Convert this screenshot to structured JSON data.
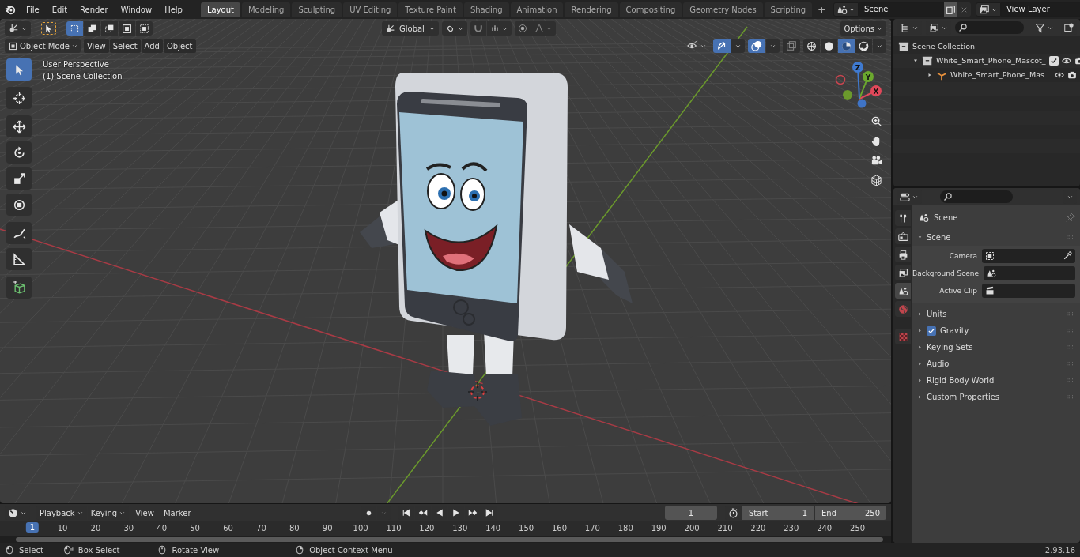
{
  "top_bar": {
    "menu": [
      "File",
      "Edit",
      "Render",
      "Window",
      "Help"
    ],
    "workspaces": [
      {
        "label": "Layout",
        "selected": true
      },
      {
        "label": "Modeling",
        "selected": false
      },
      {
        "label": "Sculpting",
        "selected": false
      },
      {
        "label": "UV Editing",
        "selected": false
      },
      {
        "label": "Texture Paint",
        "selected": false
      },
      {
        "label": "Shading",
        "selected": false
      },
      {
        "label": "Animation",
        "selected": false
      },
      {
        "label": "Rendering",
        "selected": false
      },
      {
        "label": "Compositing",
        "selected": false
      },
      {
        "label": "Geometry Nodes",
        "selected": false
      },
      {
        "label": "Scripting",
        "selected": false
      }
    ],
    "add_workspace": "+",
    "scene": "Scene",
    "view_layer": "View Layer"
  },
  "viewport": {
    "select_modes": [
      {
        "selected": true
      },
      {
        "selected": false
      },
      {
        "selected": false
      },
      {
        "selected": false
      },
      {
        "selected": false
      }
    ],
    "orientation": "Global",
    "options": "Options",
    "mode": "Object Mode",
    "menus": [
      "View",
      "Select",
      "Add",
      "Object"
    ],
    "gizmos_on": true,
    "overlays_on": true,
    "xray_on": false,
    "shading_modes": [
      {
        "selected": false
      },
      {
        "selected": false
      },
      {
        "selected": true
      },
      {
        "selected": false
      }
    ],
    "tools": [
      {
        "selected": true
      },
      {
        "selected": false
      },
      {
        "selected": false
      },
      {
        "selected": false
      },
      {
        "selected": false
      },
      {
        "selected": false
      },
      {
        "selected": false
      },
      {
        "selected": false
      },
      {
        "selected": false
      }
    ],
    "overlay_text": [
      "User Perspective",
      "(1) Scene Collection"
    ],
    "gizmo": {
      "x": "X",
      "y": "Y",
      "z": "Z"
    }
  },
  "outliner": {
    "tree": [
      {
        "label": "Scene Collection",
        "children": [
          {
            "label": "White_Smart_Phone_Mascot_",
            "expanded": true,
            "checked": true,
            "children": [
              {
                "label": "White_Smart_Phone_Mas",
                "expanded": false
              }
            ]
          }
        ]
      }
    ]
  },
  "properties": {
    "tabs": [
      {
        "selected": false
      },
      {
        "selected": false
      },
      {
        "selected": false
      },
      {
        "selected": false
      },
      {
        "selected": true
      },
      {
        "selected": false
      },
      {
        "selected": false
      }
    ],
    "context": "Scene",
    "panel": {
      "title": "Scene",
      "expanded": true,
      "fields": [
        {
          "label": "Camera"
        },
        {
          "label": "Background Scene"
        },
        {
          "label": "Active Clip"
        }
      ]
    },
    "subpanels": [
      {
        "label": "Units",
        "kind": "plain",
        "expanded": false
      },
      {
        "label": "Gravity",
        "kind": "checkbox",
        "checked": true,
        "expanded": false
      },
      {
        "label": "Keying Sets",
        "kind": "plain",
        "expanded": false
      },
      {
        "label": "Audio",
        "kind": "plain",
        "expanded": false
      },
      {
        "label": "Rigid Body World",
        "kind": "plain",
        "expanded": false
      },
      {
        "label": "Custom Properties",
        "kind": "plain",
        "expanded": false
      }
    ]
  },
  "timeline": {
    "dropdowns": [
      "Playback",
      "Keying"
    ],
    "menus": [
      "View",
      "Marker"
    ],
    "current_frame": "1",
    "start_label": "Start",
    "start": "1",
    "end_label": "End",
    "end": "250",
    "ruler_current": "1",
    "ruler_ticks": [
      "10",
      "20",
      "30",
      "40",
      "50",
      "60",
      "70",
      "80",
      "90",
      "100",
      "110",
      "120",
      "130",
      "140",
      "150",
      "160",
      "170",
      "180",
      "190",
      "200",
      "210",
      "220",
      "230",
      "240",
      "250"
    ]
  },
  "status_bar": {
    "hints": [
      {
        "label": "Select",
        "kind": "left"
      },
      {
        "label": "Box Select",
        "kind": "drag"
      },
      {
        "label": "Rotate View",
        "kind": "middle"
      },
      {
        "label": "Object Context Menu",
        "kind": "right"
      }
    ],
    "version": "2.93.16"
  }
}
